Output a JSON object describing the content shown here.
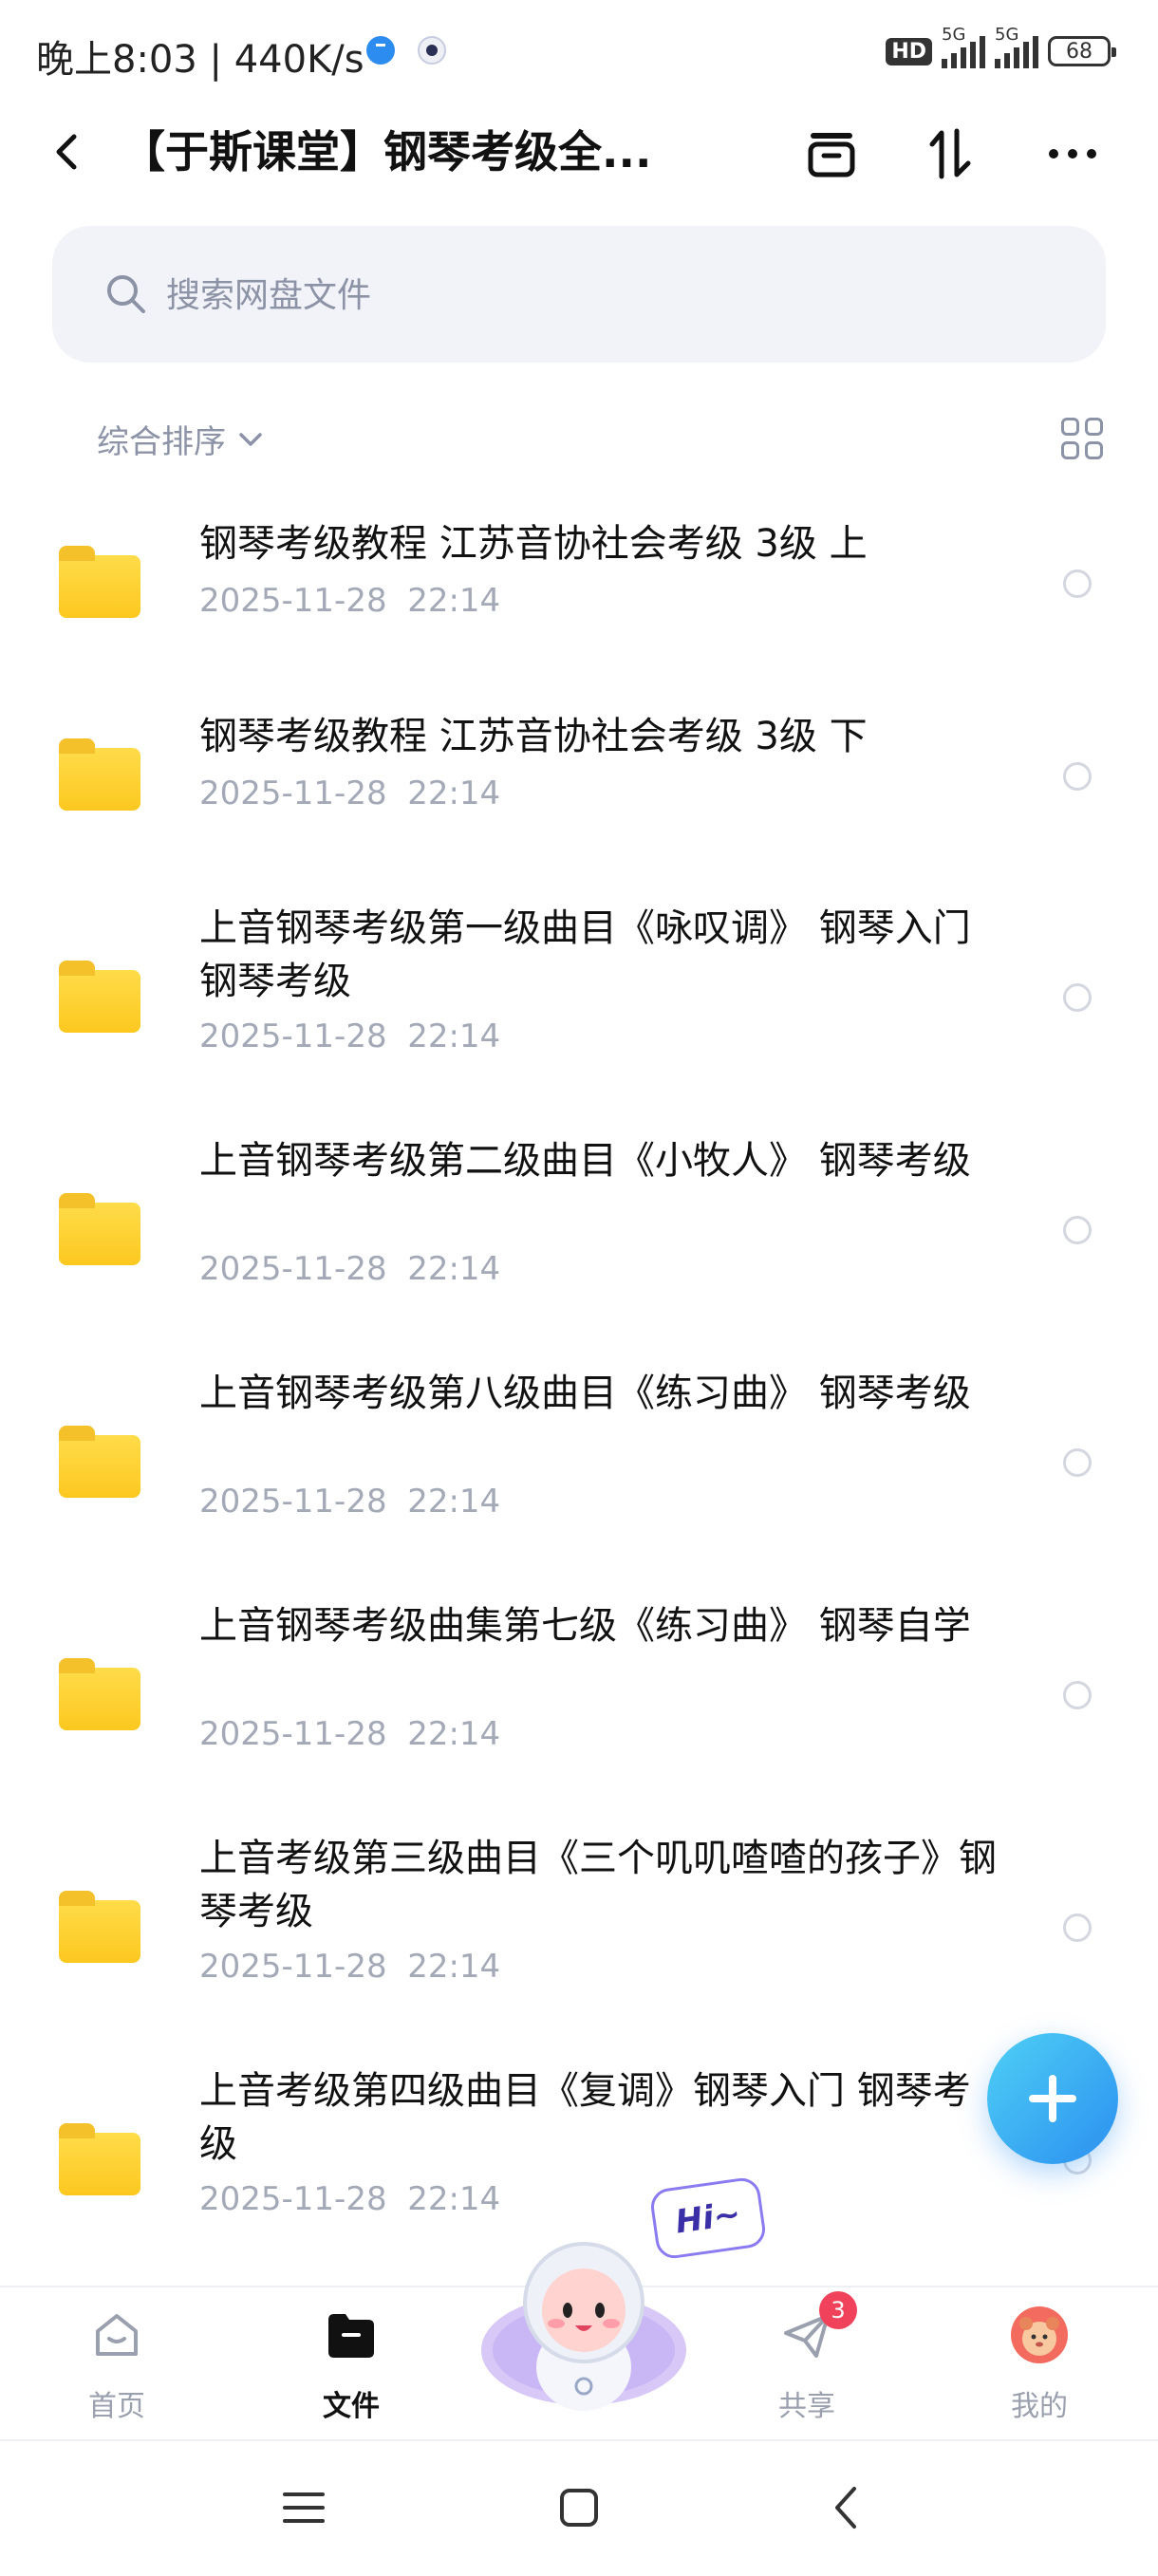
{
  "status_bar": {
    "time": "晚上8:03 | 440K/s",
    "hd_label": "HD",
    "network_1": "5G",
    "network_2": "5G",
    "battery": "68"
  },
  "header": {
    "title": "【于斯课堂】钢琴考级全..."
  },
  "search": {
    "placeholder": "搜索网盘文件"
  },
  "sort": {
    "label": "综合排序"
  },
  "files": [
    {
      "name": "钢琴考级教程 江苏音协社会考级 3级 上",
      "date": "2025-11-28  22:14"
    },
    {
      "name": "钢琴考级教程 江苏音协社会考级 3级 下",
      "date": "2025-11-28  22:14"
    },
    {
      "name": "上音钢琴考级第一级曲目《咏叹调》 钢琴入门 钢琴考级",
      "date": "2025-11-28  22:14"
    },
    {
      "name": "上音钢琴考级第二级曲目《小牧人》 钢琴考级",
      "date": "2025-11-28  22:14"
    },
    {
      "name": "上音钢琴考级第八级曲目《练习曲》 钢琴考级",
      "date": "2025-11-28  22:14"
    },
    {
      "name": "上音钢琴考级曲集第七级《练习曲》 钢琴自学",
      "date": "2025-11-28  22:14"
    },
    {
      "name": "上音考级第三级曲目《三个叽叽喳喳的孩子》钢琴考级",
      "date": "2025-11-28  22:14"
    },
    {
      "name": "上音考级第四级曲目《复调》钢琴入门 钢琴考级",
      "date": "2025-11-28  22:14"
    }
  ],
  "bubble": {
    "text": "Hi~"
  },
  "bottom_nav": {
    "home": "首页",
    "files": "文件",
    "share": "共享",
    "share_badge": "3",
    "mine": "我的"
  },
  "colors": {
    "accent": "#2b8ff0",
    "folder": "#fcc81f",
    "badge": "#f0425a"
  }
}
